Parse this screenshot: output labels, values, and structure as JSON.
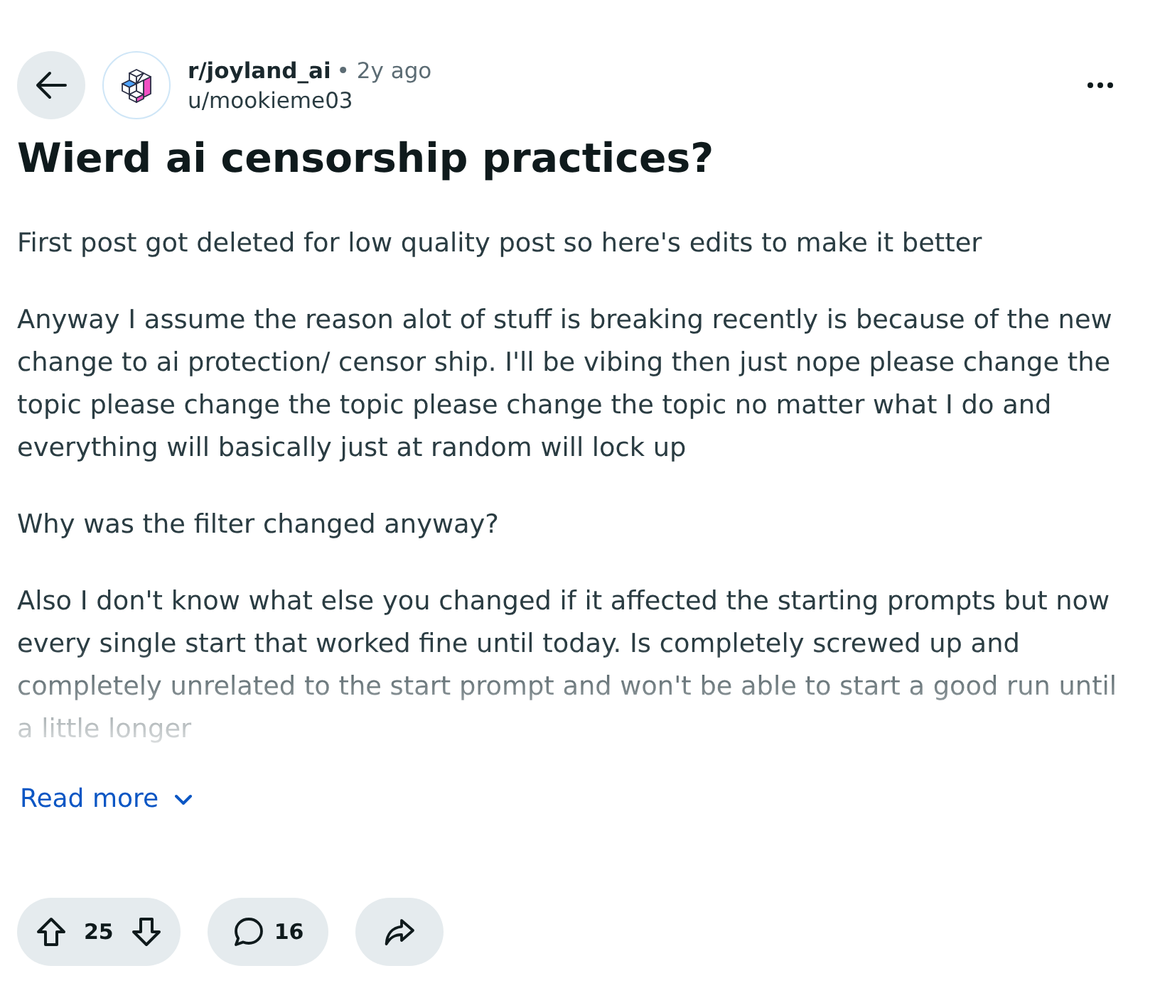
{
  "header": {
    "community": "r/joyland_ai",
    "time": "• 2y ago",
    "author": "u/mookieme03"
  },
  "title": "Wierd ai censorship practices?",
  "body": [
    "First post got deleted for low quality post so here's edits to make it better",
    "Anyway I assume the reason alot of stuff is breaking recently is because of the new change to ai protection/ censor ship. I'll be vibing then just nope please change the topic please change the topic please change the topic no matter what I do and everything will basically just at random will lock up",
    "Why was the filter changed anyway?",
    "Also I don't know what else you changed if it affected the starting prompts but now every single start that worked fine until today. Is completely screwed up and completely unrelated to the start prompt and won't be able to start a good run until a little longer"
  ],
  "read_more": "Read more",
  "actions": {
    "votes": "25",
    "comments": "16"
  }
}
